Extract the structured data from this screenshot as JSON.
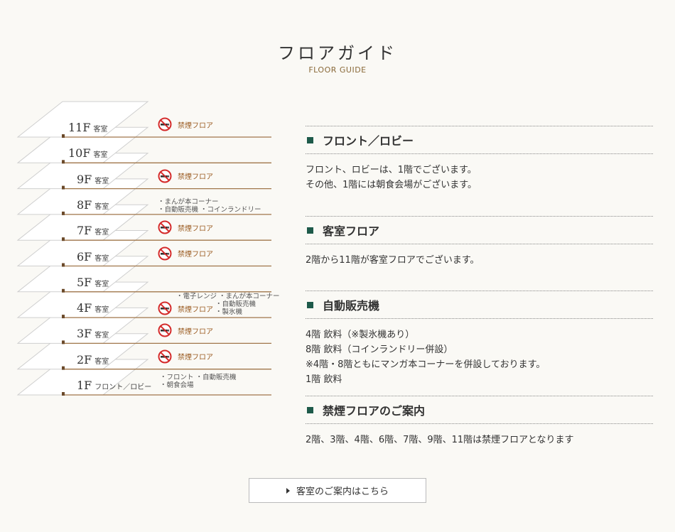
{
  "header": {
    "title": "フロアガイド",
    "subtitle": "FLOOR GUIDE"
  },
  "floors": [
    {
      "num": "11F",
      "name": "客室",
      "non_smoking": "禁煙フロア"
    },
    {
      "num": "10F",
      "name": "客室"
    },
    {
      "num": "9F",
      "name": "客室",
      "non_smoking": "禁煙フロア"
    },
    {
      "num": "8F",
      "name": "客室",
      "facilities": [
        "・まんが本コーナー",
        "・自動販売機 ・コインランドリー"
      ]
    },
    {
      "num": "7F",
      "name": "客室",
      "non_smoking": "禁煙フロア"
    },
    {
      "num": "6F",
      "name": "客室",
      "non_smoking": "禁煙フロア"
    },
    {
      "num": "5F",
      "name": "客室"
    },
    {
      "num": "4F",
      "name": "客室",
      "non_smoking": "禁煙フロア",
      "facilities": [
        "・電子レンジ ・まんが本コーナー",
        "・自動販売機",
        "・製氷機"
      ]
    },
    {
      "num": "3F",
      "name": "客室",
      "non_smoking": "禁煙フロア"
    },
    {
      "num": "2F",
      "name": "客室",
      "non_smoking": "禁煙フロア"
    },
    {
      "num": "1F",
      "name": "フロント／ロビー",
      "facilities": [
        "・フロント ・自動販売機",
        "・朝食会場"
      ]
    }
  ],
  "sections": [
    {
      "title": "フロント／ロビー",
      "lines": [
        "フロント、ロビーは、1階でございます。",
        "その他、1階には朝食会場がございます。"
      ]
    },
    {
      "title": "客室フロア",
      "lines": [
        "2階から11階が客室フロアでございます。"
      ]
    },
    {
      "title": "自動販売機",
      "lines": [
        "4階 飲料（※製氷機あり）",
        "8階 飲料（コインランドリー併設）",
        "※4階・8階ともにマンガ本コーナーを併設しております。",
        "1階 飲料"
      ]
    },
    {
      "title": "禁煙フロアのご案内",
      "lines": [
        "2階、3階、4階、6階、7階、9階、11階は禁煙フロアとなります"
      ]
    }
  ],
  "button": {
    "label": "客室のご案内はこちら"
  },
  "colors": {
    "accent_square": "#1e5a4a",
    "brown_line": "#a0764a",
    "no_smoking_red": "#d42a2a"
  },
  "icons": {
    "no_smoking": "no-smoking-icon",
    "button_arrow": "triangle-right-icon"
  }
}
